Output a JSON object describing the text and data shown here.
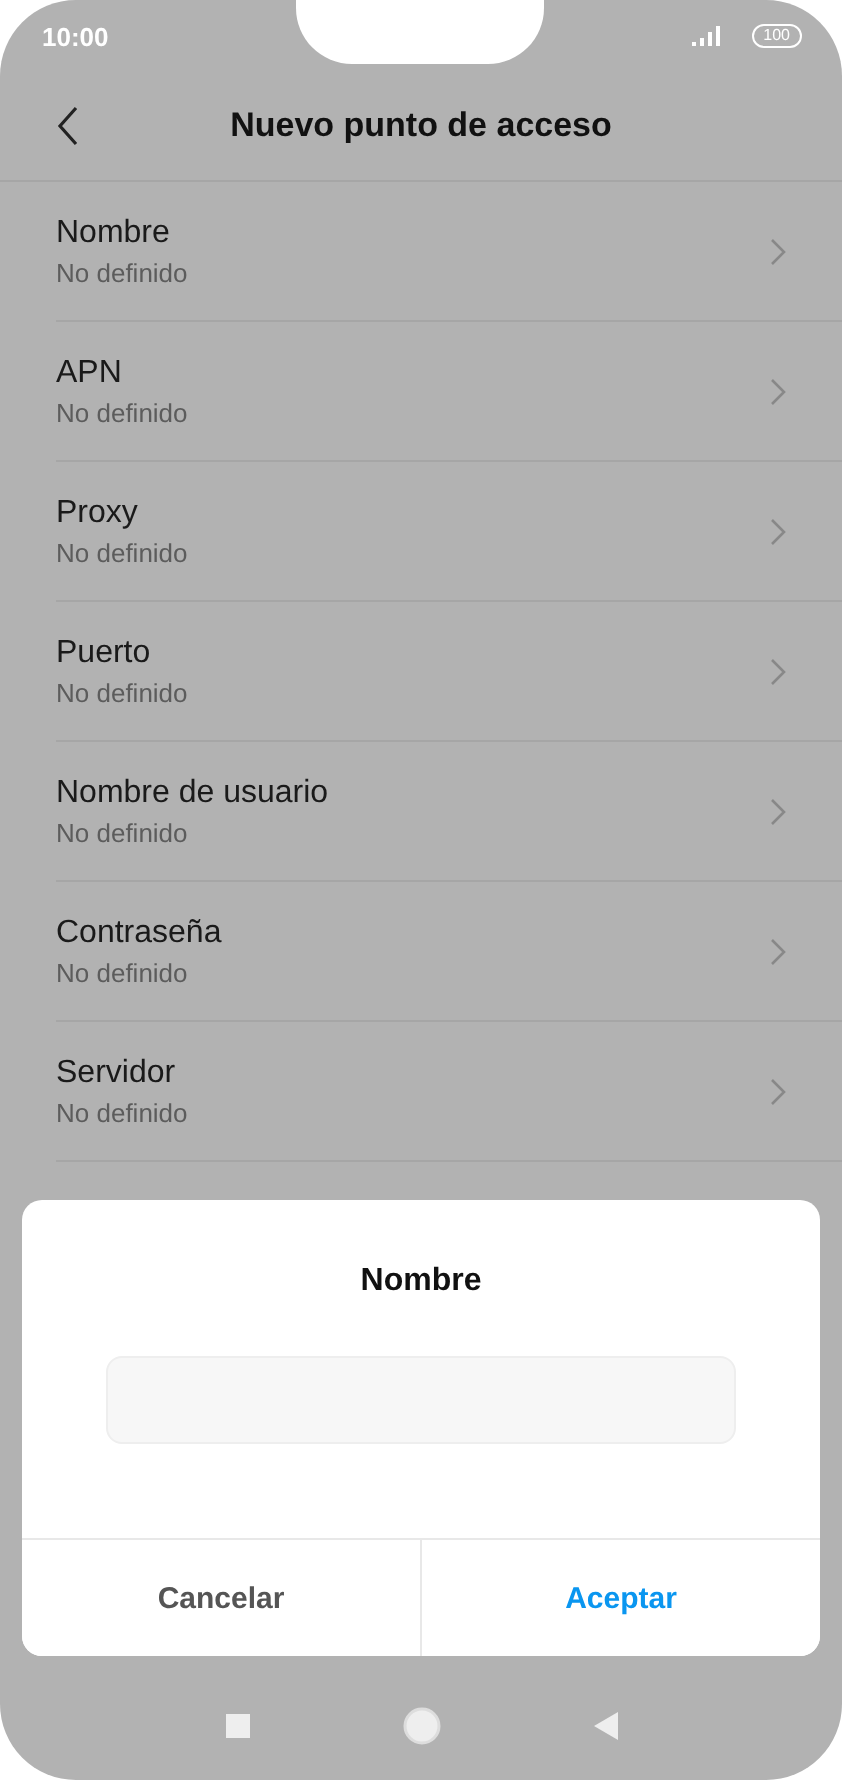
{
  "status_bar": {
    "time": "10:00",
    "battery": "100"
  },
  "header": {
    "title": "Nuevo punto de acceso"
  },
  "items": [
    {
      "label": "Nombre",
      "value": "No definido"
    },
    {
      "label": "APN",
      "value": "No definido"
    },
    {
      "label": "Proxy",
      "value": "No definido"
    },
    {
      "label": "Puerto",
      "value": "No definido"
    },
    {
      "label": "Nombre de usuario",
      "value": "No definido"
    },
    {
      "label": "Contraseña",
      "value": "No definido"
    },
    {
      "label": "Servidor",
      "value": "No definido"
    }
  ],
  "dialog": {
    "title": "Nombre",
    "buttons": [
      {
        "label": "Cancelar",
        "kind": "secondary"
      },
      {
        "label": "Aceptar",
        "kind": "primary"
      }
    ]
  }
}
